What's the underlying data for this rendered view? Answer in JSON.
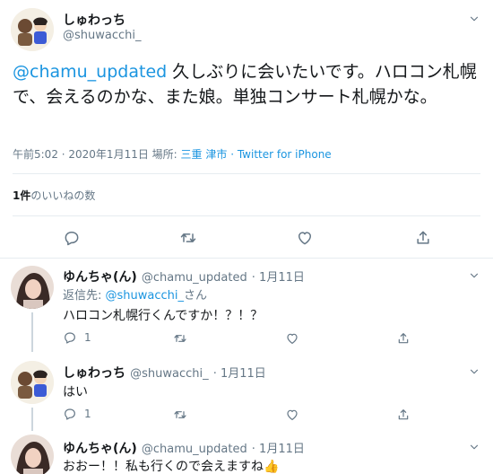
{
  "main_tweet": {
    "display_name": "しゅわっち",
    "handle": "@shuwacchi_",
    "mention": "@chamu_updated",
    "text": " 久しぶりに会いたいです。ハロコン札幌で、会えるのかな、また娘。単独コンサート札幌かな。",
    "time": "午前5:02 · 2020年1月11日",
    "place_label": "場所:",
    "place": "三重 津市",
    "source": "· Twitter for iPhone",
    "likes_count": "1件",
    "likes_label": "のいいねの数"
  },
  "replies": [
    {
      "display_name": "ゆんちゃ(ん)",
      "handle": "@chamu_updated",
      "date": "· 1月11日",
      "reply_to_label": "返信先: ",
      "reply_to_handle": "@shuwacchi_",
      "reply_to_suffix": "さん",
      "text": "ハロコン札幌行くんですか！？！？",
      "reply_count": "1"
    },
    {
      "display_name": "しゅわっち",
      "handle": "@shuwacchi_",
      "date": "· 1月11日",
      "text": "はい",
      "reply_count": "1"
    },
    {
      "display_name": "ゆんちゃ(ん)",
      "handle": "@chamu_updated",
      "date": "· 1月11日",
      "text": "おおー！！私も行くので会えますね👍"
    }
  ],
  "colors": {
    "link": "#1b95e0",
    "muted": "#657786",
    "text": "#14171a",
    "divider": "#e6ecf0"
  },
  "icons": [
    "chevron-down-icon",
    "reply-icon",
    "retweet-icon",
    "like-icon",
    "share-icon"
  ]
}
